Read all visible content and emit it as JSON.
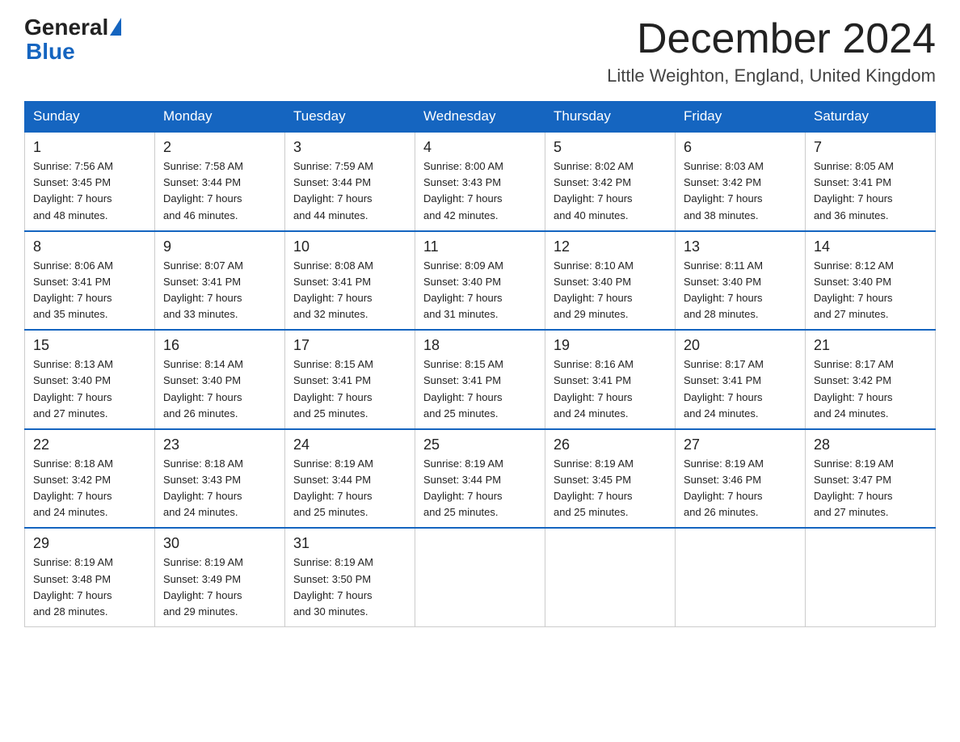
{
  "header": {
    "logo_general": "General",
    "logo_blue": "Blue",
    "month_title": "December 2024",
    "location": "Little Weighton, England, United Kingdom"
  },
  "days_of_week": [
    "Sunday",
    "Monday",
    "Tuesday",
    "Wednesday",
    "Thursday",
    "Friday",
    "Saturday"
  ],
  "weeks": [
    [
      {
        "day": "1",
        "sunrise": "7:56 AM",
        "sunset": "3:45 PM",
        "daylight": "7 hours and 48 minutes."
      },
      {
        "day": "2",
        "sunrise": "7:58 AM",
        "sunset": "3:44 PM",
        "daylight": "7 hours and 46 minutes."
      },
      {
        "day": "3",
        "sunrise": "7:59 AM",
        "sunset": "3:44 PM",
        "daylight": "7 hours and 44 minutes."
      },
      {
        "day": "4",
        "sunrise": "8:00 AM",
        "sunset": "3:43 PM",
        "daylight": "7 hours and 42 minutes."
      },
      {
        "day": "5",
        "sunrise": "8:02 AM",
        "sunset": "3:42 PM",
        "daylight": "7 hours and 40 minutes."
      },
      {
        "day": "6",
        "sunrise": "8:03 AM",
        "sunset": "3:42 PM",
        "daylight": "7 hours and 38 minutes."
      },
      {
        "day": "7",
        "sunrise": "8:05 AM",
        "sunset": "3:41 PM",
        "daylight": "7 hours and 36 minutes."
      }
    ],
    [
      {
        "day": "8",
        "sunrise": "8:06 AM",
        "sunset": "3:41 PM",
        "daylight": "7 hours and 35 minutes."
      },
      {
        "day": "9",
        "sunrise": "8:07 AM",
        "sunset": "3:41 PM",
        "daylight": "7 hours and 33 minutes."
      },
      {
        "day": "10",
        "sunrise": "8:08 AM",
        "sunset": "3:41 PM",
        "daylight": "7 hours and 32 minutes."
      },
      {
        "day": "11",
        "sunrise": "8:09 AM",
        "sunset": "3:40 PM",
        "daylight": "7 hours and 31 minutes."
      },
      {
        "day": "12",
        "sunrise": "8:10 AM",
        "sunset": "3:40 PM",
        "daylight": "7 hours and 29 minutes."
      },
      {
        "day": "13",
        "sunrise": "8:11 AM",
        "sunset": "3:40 PM",
        "daylight": "7 hours and 28 minutes."
      },
      {
        "day": "14",
        "sunrise": "8:12 AM",
        "sunset": "3:40 PM",
        "daylight": "7 hours and 27 minutes."
      }
    ],
    [
      {
        "day": "15",
        "sunrise": "8:13 AM",
        "sunset": "3:40 PM",
        "daylight": "7 hours and 27 minutes."
      },
      {
        "day": "16",
        "sunrise": "8:14 AM",
        "sunset": "3:40 PM",
        "daylight": "7 hours and 26 minutes."
      },
      {
        "day": "17",
        "sunrise": "8:15 AM",
        "sunset": "3:41 PM",
        "daylight": "7 hours and 25 minutes."
      },
      {
        "day": "18",
        "sunrise": "8:15 AM",
        "sunset": "3:41 PM",
        "daylight": "7 hours and 25 minutes."
      },
      {
        "day": "19",
        "sunrise": "8:16 AM",
        "sunset": "3:41 PM",
        "daylight": "7 hours and 24 minutes."
      },
      {
        "day": "20",
        "sunrise": "8:17 AM",
        "sunset": "3:41 PM",
        "daylight": "7 hours and 24 minutes."
      },
      {
        "day": "21",
        "sunrise": "8:17 AM",
        "sunset": "3:42 PM",
        "daylight": "7 hours and 24 minutes."
      }
    ],
    [
      {
        "day": "22",
        "sunrise": "8:18 AM",
        "sunset": "3:42 PM",
        "daylight": "7 hours and 24 minutes."
      },
      {
        "day": "23",
        "sunrise": "8:18 AM",
        "sunset": "3:43 PM",
        "daylight": "7 hours and 24 minutes."
      },
      {
        "day": "24",
        "sunrise": "8:19 AM",
        "sunset": "3:44 PM",
        "daylight": "7 hours and 25 minutes."
      },
      {
        "day": "25",
        "sunrise": "8:19 AM",
        "sunset": "3:44 PM",
        "daylight": "7 hours and 25 minutes."
      },
      {
        "day": "26",
        "sunrise": "8:19 AM",
        "sunset": "3:45 PM",
        "daylight": "7 hours and 25 minutes."
      },
      {
        "day": "27",
        "sunrise": "8:19 AM",
        "sunset": "3:46 PM",
        "daylight": "7 hours and 26 minutes."
      },
      {
        "day": "28",
        "sunrise": "8:19 AM",
        "sunset": "3:47 PM",
        "daylight": "7 hours and 27 minutes."
      }
    ],
    [
      {
        "day": "29",
        "sunrise": "8:19 AM",
        "sunset": "3:48 PM",
        "daylight": "7 hours and 28 minutes."
      },
      {
        "day": "30",
        "sunrise": "8:19 AM",
        "sunset": "3:49 PM",
        "daylight": "7 hours and 29 minutes."
      },
      {
        "day": "31",
        "sunrise": "8:19 AM",
        "sunset": "3:50 PM",
        "daylight": "7 hours and 30 minutes."
      },
      null,
      null,
      null,
      null
    ]
  ]
}
